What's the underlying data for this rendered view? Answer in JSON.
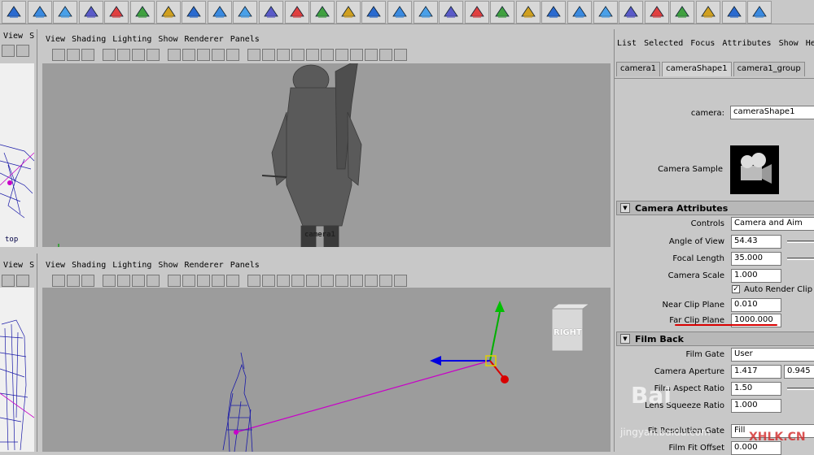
{
  "shelf": {
    "icons": [
      "sphere-icon",
      "cube-icon",
      "cylinder-icon",
      "cone-icon",
      "plane-icon",
      "torus-icon",
      "nurbs-plane-icon",
      "poly-cylinder-icon",
      "sculpt-icon",
      "circle-icon",
      "cv-curve-icon",
      "subdiv-icon",
      "poly-sphere-icon",
      "poly-cube-icon",
      "poly-plane-icon",
      "select-arrow-icon",
      "extrude-icon",
      "split-icon",
      "poly-ops-icon",
      "checker-icon",
      "lattice-icon",
      "deform-icon",
      "bend-icon",
      "wave-icon",
      "cluster-icon",
      "light-icon",
      "render-icon",
      "sphere-check-icon",
      "gear-check-icon",
      "camera-check-icon"
    ]
  },
  "top_left_panel": {
    "menu": [
      "View",
      "S"
    ],
    "label": "top"
  },
  "top_main_panel": {
    "menu": [
      "View",
      "Shading",
      "Lighting",
      "Show",
      "Renderer",
      "Panels"
    ],
    "camera_label": "camera1"
  },
  "bottom_left_panel": {
    "menu": [
      "View",
      "S"
    ]
  },
  "bottom_main_panel": {
    "menu": [
      "View",
      "Shading",
      "Lighting",
      "Show",
      "Renderer",
      "Panels"
    ],
    "view_cube_label": "RIGHT"
  },
  "attribute_editor": {
    "menu": [
      "List",
      "Selected",
      "Focus",
      "Attributes",
      "Show",
      "Help"
    ],
    "tabs": [
      "camera1",
      "cameraShape1",
      "camera1_group"
    ],
    "camera_label": "camera:",
    "camera_value": "cameraShape1",
    "camera_sample_label": "Camera Sample",
    "sections": {
      "camera_attributes": "Camera Attributes",
      "film_back": "Film Back"
    },
    "fields": {
      "controls_label": "Controls",
      "controls_value": "Camera and Aim",
      "angle_of_view_label": "Angle of View",
      "angle_of_view_value": "54.43",
      "focal_length_label": "Focal Length",
      "focal_length_value": "35.000",
      "camera_scale_label": "Camera Scale",
      "camera_scale_value": "1.000",
      "auto_render_clip_label": "Auto Render Clip Pl",
      "near_clip_label": "Near Clip Plane",
      "near_clip_value": "0.010",
      "far_clip_label": "Far Clip Plane",
      "far_clip_value": "1000.000",
      "film_gate_label": "Film Gate",
      "film_gate_value": "User",
      "camera_aperture_label": "Camera Aperture",
      "camera_aperture_value1": "1.417",
      "camera_aperture_value2": "0.945",
      "film_aspect_label": "Film Aspect Ratio",
      "film_aspect_value": "1.50",
      "lens_squeeze_label": "Lens Squeeze Ratio",
      "lens_squeeze_value": "1.000",
      "fit_resolution_label": "Fit Resolution Gate",
      "fit_resolution_value": "Fill",
      "film_fit_offset_label": "Film Fit Offset",
      "film_fit_offset_value": "0.000"
    }
  },
  "watermarks": {
    "baidu": "Bai",
    "jingyan": "jingyan.baidu.com",
    "site": "XHLK.CN"
  },
  "colors": {
    "viewport": "#9c9c9c",
    "wire": "#1a1aa8",
    "highlight": "#d80000"
  }
}
